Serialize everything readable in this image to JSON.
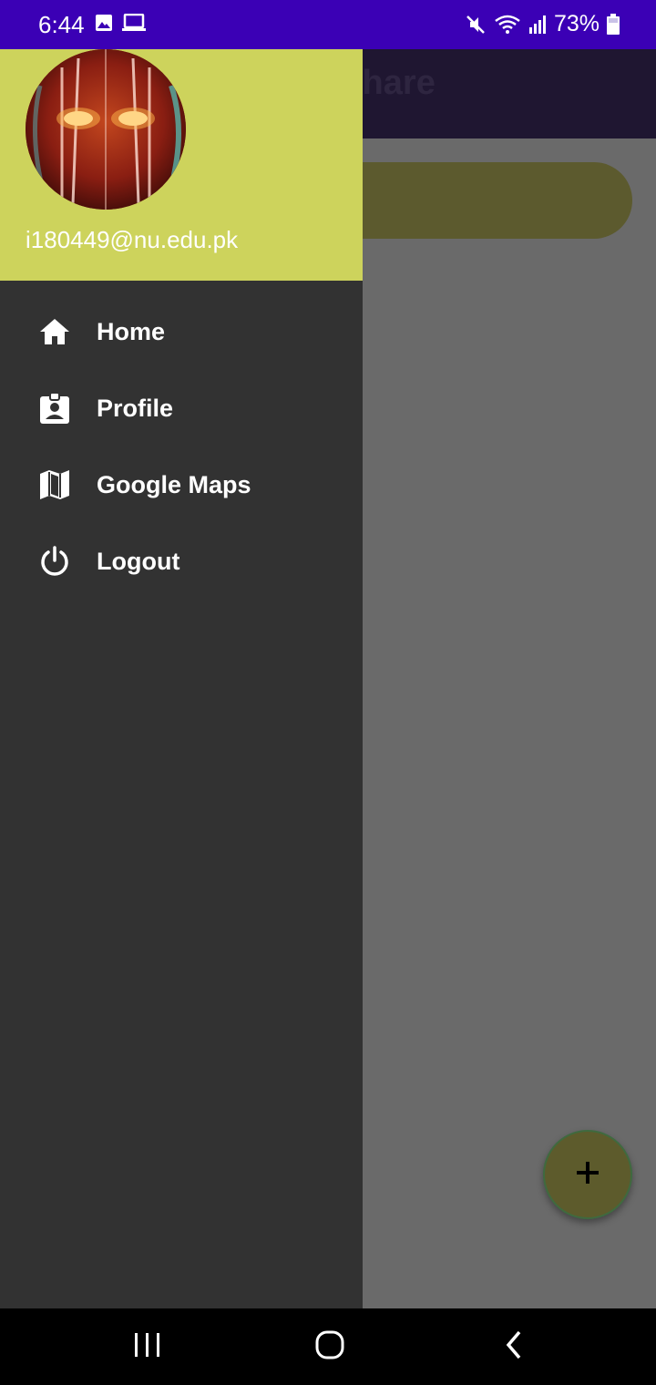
{
  "status_bar": {
    "time": "6:44",
    "battery": "73%",
    "icons": [
      "image-icon",
      "laptop-icon",
      "mute-icon",
      "wifi-icon",
      "signal-icon",
      "battery-icon"
    ]
  },
  "app": {
    "title_partial": "odshare"
  },
  "drawer": {
    "header_bg": "#cdd35c",
    "email": "i180449@nu.edu.pk",
    "items": [
      {
        "label": "Home",
        "icon": "home-icon"
      },
      {
        "label": "Profile",
        "icon": "profile-badge-icon"
      },
      {
        "label": "Google Maps",
        "icon": "map-icon"
      },
      {
        "label": "Logout",
        "icon": "power-icon"
      }
    ]
  },
  "fab": {
    "label": "+",
    "icon": "plus-icon"
  },
  "nav_bar": {
    "buttons": [
      "recents-icon",
      "home-circle-icon",
      "back-icon"
    ]
  },
  "colors": {
    "status_bar": "#3b00b5",
    "drawer_bg": "#323232",
    "scrim": "#6a6a6a"
  }
}
